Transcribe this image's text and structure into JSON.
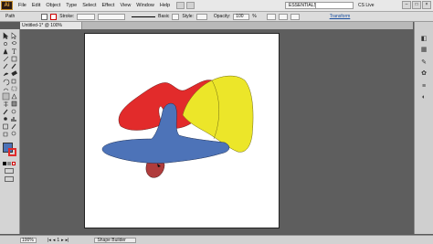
{
  "app": {
    "logo": "Ai"
  },
  "menubar": {
    "items": [
      "File",
      "Edit",
      "Object",
      "Type",
      "Select",
      "Effect",
      "View",
      "Window",
      "Help"
    ],
    "workspace": "ESSENTIALS",
    "cs_live": "CS Live",
    "window_buttons": [
      "–",
      "□",
      "×"
    ]
  },
  "controlbar": {
    "selection_label": "Path",
    "stroke_label": "Stroke:",
    "brush_label": "Basic",
    "style_label": "Style:",
    "opacity_label": "Opacity:",
    "opacity_value": "100",
    "opacity_unit": "%",
    "transform_label": "Transform",
    "colors": {
      "fill": "#ffffff",
      "stroke": "#000000"
    }
  },
  "document": {
    "tab_title": "Untitled-1* @ 100% (CMYK/Preview)"
  },
  "shapes": {
    "colors": {
      "red": "#e22b2b",
      "yellow": "#ece629",
      "blue": "#4d73b8",
      "maroon": "#b03c3c"
    }
  },
  "statusbar": {
    "zoom": "100%",
    "page": "1",
    "tool": "Shape Builder"
  },
  "toolbar": {
    "tools": [
      "selection-tool",
      "direct-selection-tool",
      "magic-wand-tool",
      "lasso-tool",
      "pen-tool",
      "type-tool",
      "line-tool",
      "rectangle-tool",
      "paintbrush-tool",
      "pencil-tool",
      "blob-brush-tool",
      "eraser-tool",
      "rotate-tool",
      "scale-tool",
      "width-tool",
      "free-transform-tool",
      "shape-builder-tool",
      "perspective-grid-tool",
      "mesh-tool",
      "gradient-tool",
      "eyedropper-tool",
      "blend-tool",
      "symbol-sprayer-tool",
      "column-graph-tool",
      "artboard-tool",
      "slice-tool",
      "hand-tool",
      "zoom-tool"
    ],
    "fill_color": "#4d73b8",
    "stroke_color": "#e22b2b"
  }
}
